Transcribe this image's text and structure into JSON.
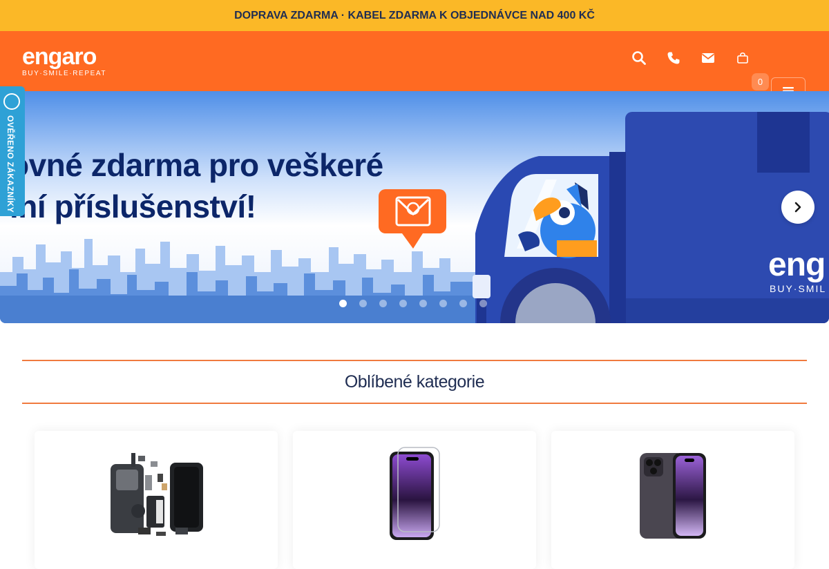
{
  "topbar": {
    "text": "DOPRAVA ZDARMA · KABEL ZDARMA K OBJEDNÁVCE NAD 400 KČ"
  },
  "header": {
    "logo": "engaro",
    "tagline": "BUY·SMILE·REPEAT",
    "cart_count": "0",
    "icons": [
      "search-icon",
      "phone-icon",
      "mail-icon",
      "shopping-bag-icon",
      "hamburger-menu-icon"
    ]
  },
  "hero": {
    "line1": "ovné zdarma pro veškeré",
    "line2": "lní příslušenství!",
    "truck_logo": "eng",
    "truck_tagline": "BUY·SMIL",
    "slide_count": 8,
    "active_slide": 1
  },
  "verified_badge": {
    "text": "OVĚŘENO ZÁKAZNÍKY"
  },
  "categories": {
    "title": "Oblíbené kategorie",
    "items": [
      {
        "image": "phone-parts"
      },
      {
        "image": "screen-protector-glass"
      },
      {
        "image": "protective-film"
      }
    ]
  },
  "colors": {
    "topbar": "#fbb827",
    "header": "#ff6a22",
    "accent_line": "#f07a3e",
    "navy": "#1f2d52",
    "badge": "#2ea1d6"
  }
}
